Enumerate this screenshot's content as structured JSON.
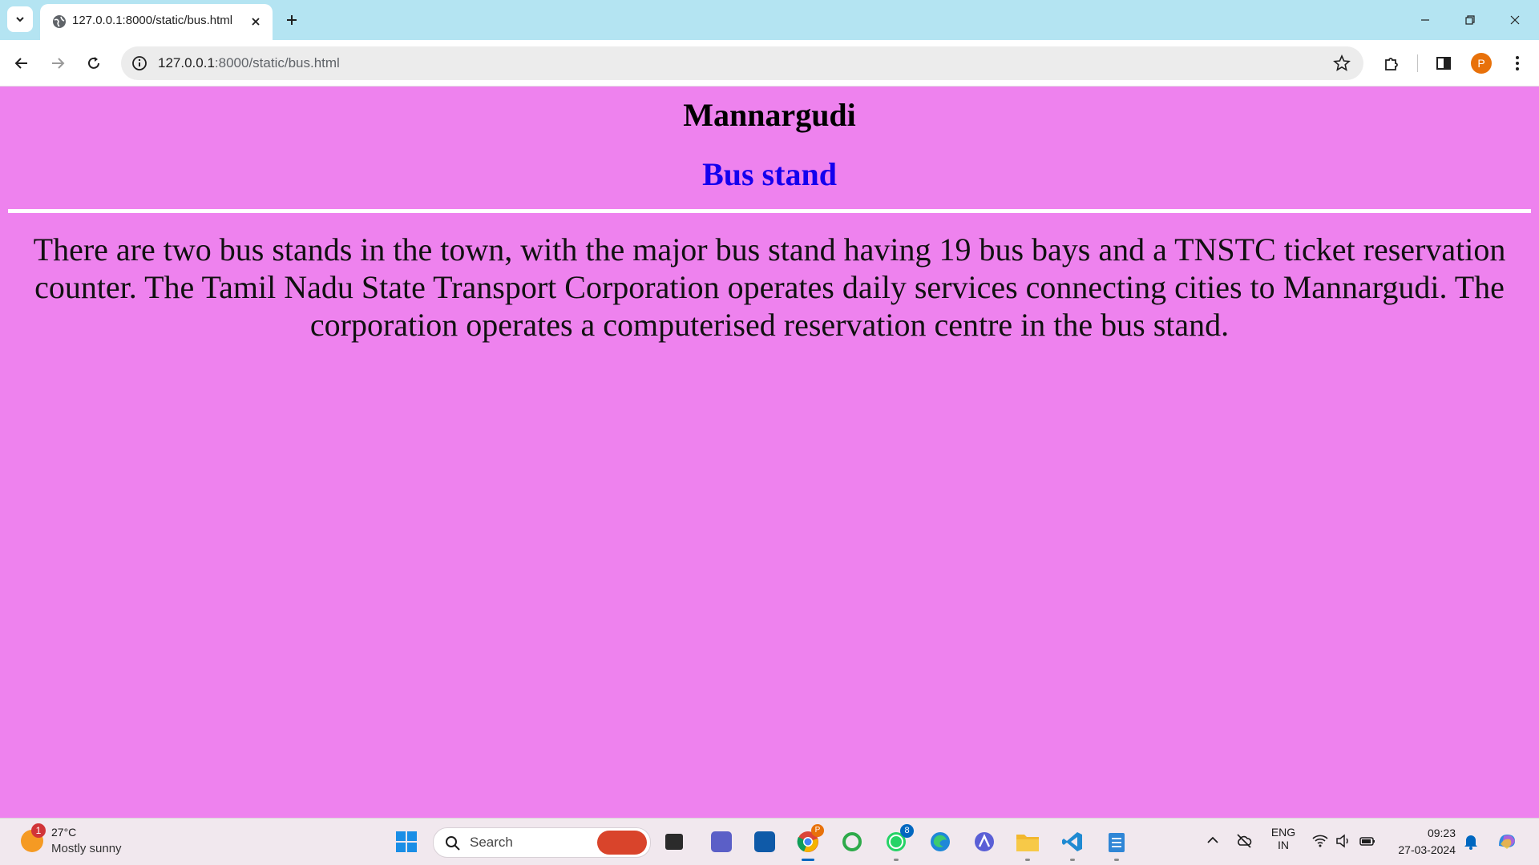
{
  "browser": {
    "tab": {
      "title": "127.0.0.1:8000/static/bus.html"
    },
    "address_bar": {
      "host": "127.0.0.1",
      "path": ":8000/static/bus.html"
    },
    "profile_initial": "P"
  },
  "page": {
    "heading": "Mannargudi",
    "subheading": "Bus stand",
    "paragraph": "There are two bus stands in the town, with the major bus stand having 19 bus bays and a TNSTC ticket reservation counter. The Tamil Nadu State Transport Corporation operates daily services connecting cities to Mannargudi. The corporation operates a computerised reservation centre in the bus stand.",
    "background_color": "#ee82ee",
    "heading_color": "#000000",
    "subheading_color": "#1400ee"
  },
  "taskbar": {
    "weather": {
      "temp": "27°C",
      "condition": "Mostly sunny",
      "badge": "1"
    },
    "search": {
      "label": "Search"
    },
    "whatsapp_badge": "8",
    "chrome_badge": "P",
    "language": {
      "line1": "ENG",
      "line2": "IN"
    },
    "clock": {
      "time": "09:23",
      "date": "27-03-2024"
    }
  }
}
